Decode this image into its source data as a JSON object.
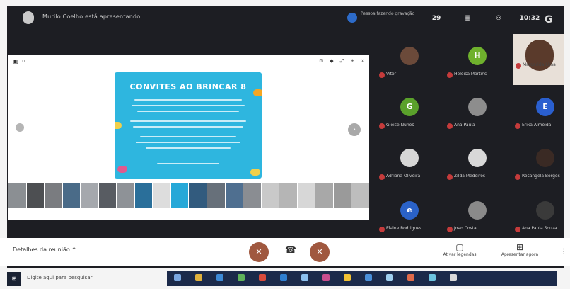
{
  "topbar": {
    "presenter_text": "Murilo Coelho está apresentando",
    "recording_text": "Pessoa fazendo gravação",
    "icons": [
      {
        "name": "participants-icon",
        "label": "29"
      },
      {
        "name": "chat-icon",
        "label": "≣"
      },
      {
        "name": "activities-icon",
        "label": "⚇"
      },
      {
        "name": "time-label",
        "label": "10:32"
      }
    ],
    "account_glyph": "G"
  },
  "share": {
    "slide_title": "CONVITES AO BRINCAR 8",
    "slide_bg": "#2eb6df",
    "thumb_colors": [
      "#8b8f93",
      "#4d4f52",
      "#7a7c80",
      "#4a6b88",
      "#a5a8ad",
      "#585c62",
      "#8e9297",
      "#2a6f9a",
      "#dddddd",
      "#26a8d8",
      "#325b7e",
      "#67707a",
      "#4f6f90",
      "#8a8d92",
      "#c9c9c9",
      "#b5b5b5",
      "#d7d7d7",
      "#a8a8a8",
      "#9a9a9a",
      "#bdbdbd"
    ]
  },
  "participants": [
    {
      "id": "p1",
      "name": "Vitor",
      "initial": "",
      "color": "#6b4a3a"
    },
    {
      "id": "p2",
      "name": "Heloisa Martins",
      "initial": "H",
      "color": "#6fb12d"
    },
    {
      "id": "p3",
      "name": "Gleice Nunes",
      "initial": "G",
      "color": "#5aa12b"
    },
    {
      "id": "p4",
      "name": "Ana Paula",
      "initial": "",
      "color": "#8d8d8d"
    },
    {
      "id": "p5",
      "name": "Erika Almeida",
      "initial": "E",
      "color": "#2a5fcf"
    },
    {
      "id": "p6",
      "name": "Adriana Oliveira",
      "initial": "",
      "color": "#d6d6d6"
    },
    {
      "id": "p7",
      "name": "Zilda Medeiros",
      "initial": "",
      "color": "#d8d8d8"
    },
    {
      "id": "p8",
      "name": "Rosangela Borges",
      "initial": "",
      "color": "#3a2a24"
    },
    {
      "id": "p9",
      "name": "Elaine Rodrigues",
      "initial": "e",
      "color": "#2a62c8"
    },
    {
      "id": "p10",
      "name": "Joao Costa",
      "initial": "",
      "color": "#8a8a8a"
    },
    {
      "id": "p11",
      "name": "Ana Paula Souza",
      "initial": "",
      "color": "#3a3a3a"
    }
  ],
  "video_tile": {
    "name": "Margarida Lima"
  },
  "controls": {
    "meeting_details": "Detalhes da reunião ^",
    "mic_glyph": "✕",
    "hangup_glyph": "☎",
    "cam_glyph": "✕",
    "present_label": "Apresentar agora",
    "captions_label": "Ativar legendas",
    "more_glyph": "⋮"
  },
  "taskbar": {
    "start_glyph": "⊞",
    "search_text": "Digite aqui para pesquisar"
  },
  "colors": {
    "meet_bg": "#1d1e23",
    "danger": "#c53b3b",
    "control_red": "#a0583f"
  }
}
